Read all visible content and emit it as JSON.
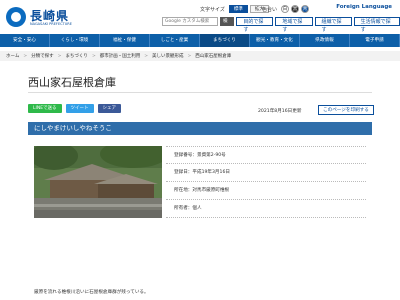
{
  "header": {
    "logo_text": "長崎県",
    "logo_sub": "NAGASAKI PREFECTURE",
    "font_size_label": "文字サイズ",
    "font_size_options": [
      "標準",
      "拡大"
    ],
    "color_label": "色合い",
    "color_options": [
      "白",
      "黒",
      "青"
    ],
    "foreign_language": "Foreign Language",
    "search_placeholder": "Google カスタム検索",
    "search_button": "検索",
    "quick_links": [
      "目的で探す",
      "地域で探す",
      "組織で探す",
      "生活情報で探す"
    ]
  },
  "nav": {
    "items": [
      "安全・安心",
      "くらし・環境",
      "福祉・保健",
      "しごと・産業",
      "まちづくり",
      "観光・教育・文化",
      "県政情報",
      "電子申請"
    ]
  },
  "breadcrumb": [
    "ホーム",
    "分類で探す",
    "まちづくり",
    "都市計画・国土利用",
    "美しい景観形成",
    "西山家石屋根倉庫"
  ],
  "page": {
    "title": "西山家石屋根倉庫",
    "share_buttons": [
      "LINEで送る",
      "ツイート",
      "シェア"
    ],
    "updated": "2021年8月16日更新",
    "update_link": "このページを印刷する",
    "section_heading": "にしやまけいしやねそうこ",
    "info": [
      "登録番号：景資第2-90号",
      "登録日：平成19年3月16日",
      "所在地：対馬市厳原町椎根",
      "所有者：個人"
    ],
    "body_text": "厳原を流れる椎根川沿いに石屋根倉庫群が残っている。"
  }
}
